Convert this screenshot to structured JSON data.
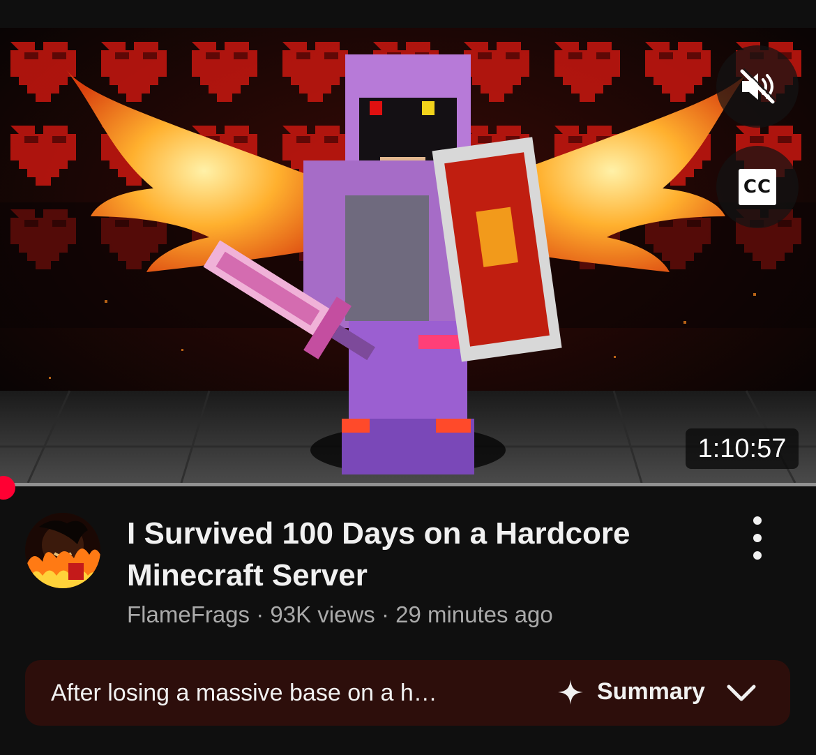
{
  "player": {
    "duration": "1:10:57",
    "progress_fraction": 0.0,
    "cc_label": "CC",
    "icons": {
      "mute": "volume-muted-icon",
      "captions": "closed-captions-icon"
    }
  },
  "video": {
    "title": "I Survived 100 Days on a Hardcore Minecraft Server",
    "channel": "FlameFrags",
    "views": "93K views",
    "age": "29 minutes ago",
    "separator": " · "
  },
  "summary": {
    "text": "After losing a massive base on a h…",
    "label": "Summary",
    "icons": {
      "sparkle": "sparkle-icon",
      "expand": "chevron-down-icon"
    }
  },
  "colors": {
    "background": "#0f0f0f",
    "progress_played": "#ff0033",
    "summary_bg": "#2d0e0b",
    "meta_text": "#aaaaaa"
  }
}
